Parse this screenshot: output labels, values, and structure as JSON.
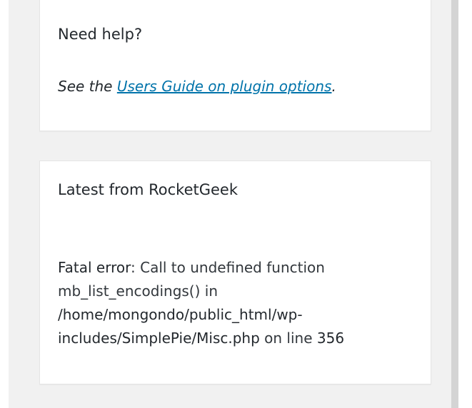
{
  "help_box": {
    "title": "Need help?",
    "text_prefix": "See the ",
    "link_text": "Users Guide on plugin options",
    "text_suffix": "."
  },
  "latest_box": {
    "title": "Latest from RocketGeek",
    "error": {
      "label": "Fatal error",
      "message": ": Call to undefined function mb_list_encodings() in ",
      "file": "/home/mongondo/public_html/wp-includes/SimplePie/Misc.php",
      "line_text": " on line ",
      "line_number": "356"
    }
  },
  "colors": {
    "background": "#f1f1f1",
    "link": "#0073aa",
    "box": "#ffffff"
  }
}
